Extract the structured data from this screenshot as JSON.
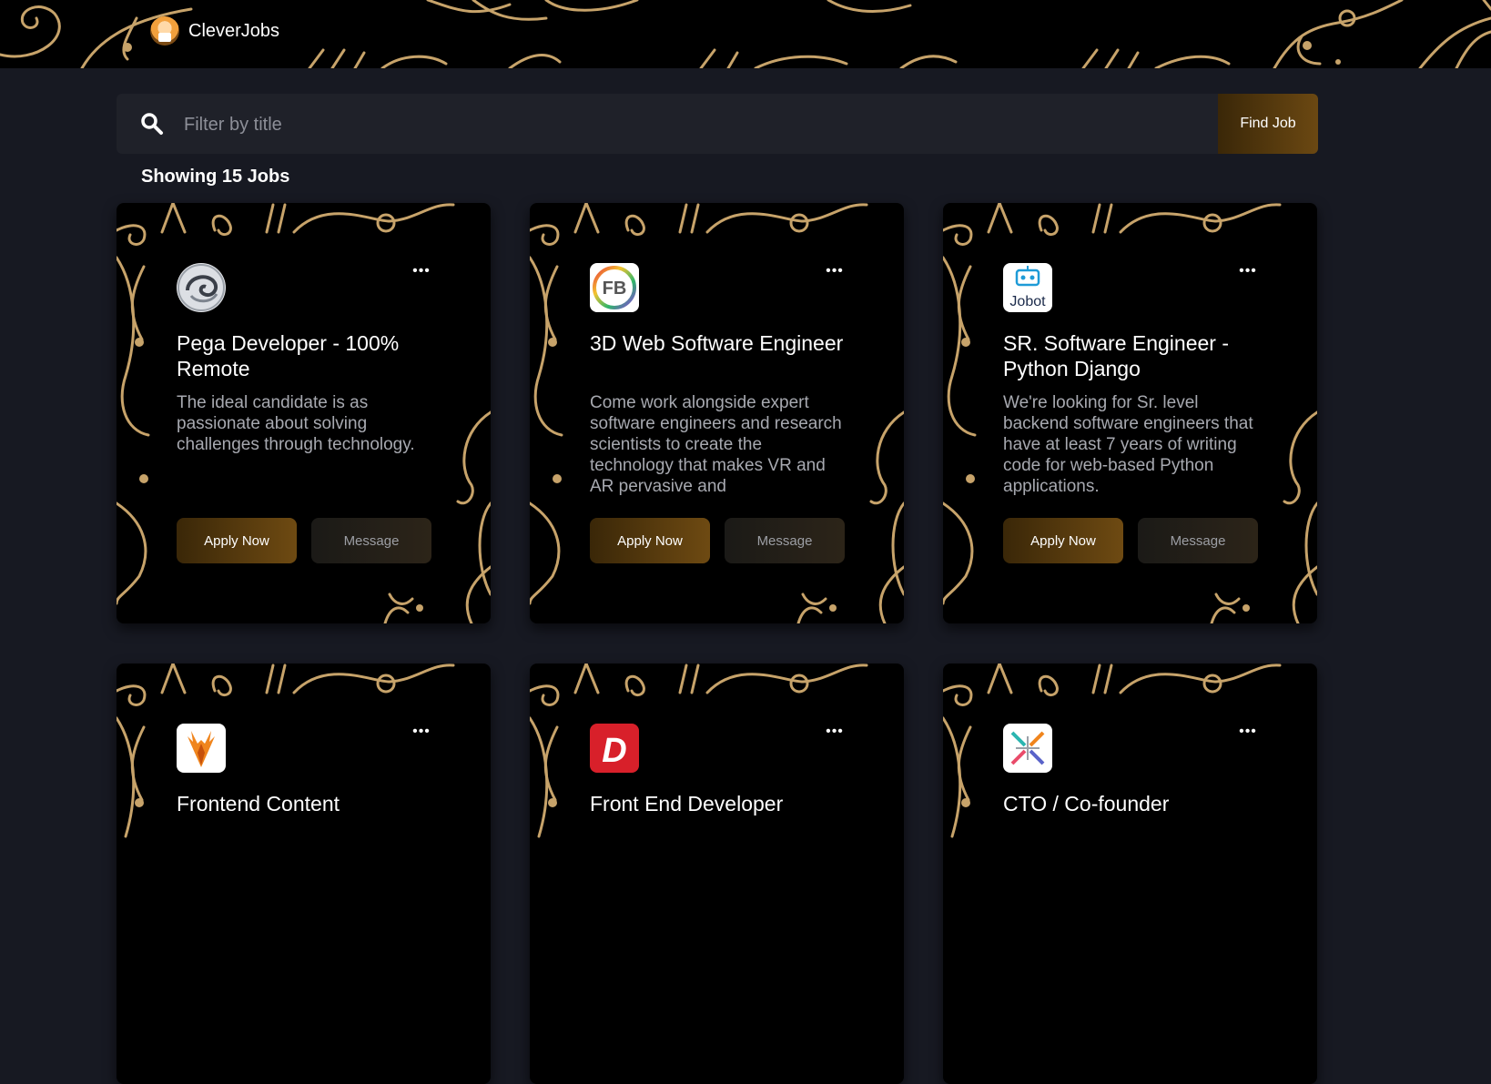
{
  "header": {
    "brand_name": "CleverJobs"
  },
  "search": {
    "placeholder": "Filter by title",
    "value": "",
    "button_label": "Find Job"
  },
  "results": {
    "count_label": "Showing 15 Jobs"
  },
  "jobs": [
    {
      "logo": "pega-swirl-logo",
      "title": "Pega Developer - 100% Remote",
      "description": "The ideal candidate is as passionate about solving challenges through technology.",
      "apply_label": "Apply Now",
      "message_label": "Message"
    },
    {
      "logo": "fb-ring-logo",
      "logo_text": "FB",
      "title": "3D Web Software Engineer",
      "description": "Come work alongside expert software engineers and research scientists to create the technology that makes VR and AR pervasive and",
      "apply_label": "Apply Now",
      "message_label": "Message"
    },
    {
      "logo": "jobot-robot-logo",
      "logo_text": "Jobot",
      "title": "SR. Software Engineer - Python Django",
      "description": "We're looking for Sr. level backend software engineers that have at least 7 years of writing code for web-based Python applications.",
      "apply_label": "Apply Now",
      "message_label": "Message"
    },
    {
      "logo": "deer-logo",
      "title": "Frontend Content",
      "description": "",
      "apply_label": "",
      "message_label": ""
    },
    {
      "logo": "d-letter-logo",
      "logo_text": "D",
      "title": "Front End Developer",
      "description": "",
      "apply_label": "",
      "message_label": ""
    },
    {
      "logo": "cross-arrows-logo",
      "title": "CTO / Co-founder",
      "description": "",
      "apply_label": "",
      "message_label": ""
    }
  ],
  "colors": {
    "accent_gold": "#c7a36a",
    "button_brown": "#5a3c0e",
    "background": "#171922",
    "card": "#000000"
  }
}
